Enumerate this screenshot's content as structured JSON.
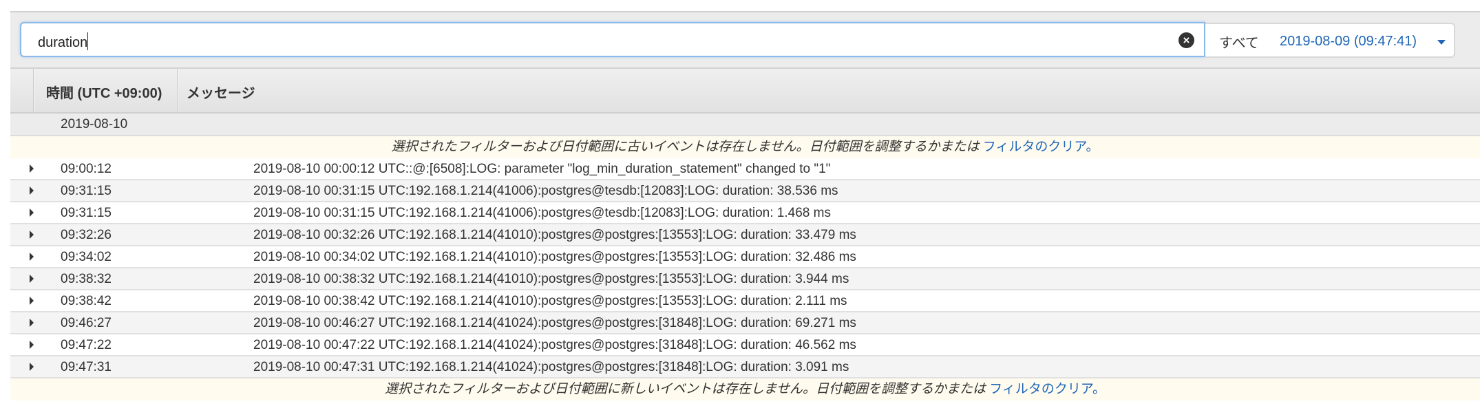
{
  "search": {
    "value": "duration",
    "clear_icon": "x-circle-icon"
  },
  "range": {
    "all_label": "すべて",
    "date_label": "2019-08-09 (09:47:41)"
  },
  "table": {
    "headers": [
      "時間 (UTC +09:00)",
      "メッセージ"
    ],
    "date_group": "2019-08-10",
    "notice_top": {
      "text": "選択されたフィルターおよび日付範囲に古いイベントは存在しません。日付範囲を調整するかまたは ",
      "link": "フィルタのクリア。"
    },
    "notice_bottom": {
      "text": "選択されたフィルターおよび日付範囲に新しいイベントは存在しません。日付範囲を調整するかまたは ",
      "link": "フィルタのクリア。"
    },
    "rows": [
      {
        "time": "09:00:12",
        "message": "2019-08-10 00:00:12 UTC::@:[6508]:LOG: parameter \"log_min_duration_statement\" changed to \"1\""
      },
      {
        "time": "09:31:15",
        "message": "2019-08-10 00:31:15 UTC:192.168.1.214(41006):postgres@tesdb:[12083]:LOG: duration: 38.536 ms"
      },
      {
        "time": "09:31:15",
        "message": "2019-08-10 00:31:15 UTC:192.168.1.214(41006):postgres@tesdb:[12083]:LOG: duration: 1.468 ms"
      },
      {
        "time": "09:32:26",
        "message": "2019-08-10 00:32:26 UTC:192.168.1.214(41010):postgres@postgres:[13553]:LOG: duration: 33.479 ms"
      },
      {
        "time": "09:34:02",
        "message": "2019-08-10 00:34:02 UTC:192.168.1.214(41010):postgres@postgres:[13553]:LOG: duration: 32.486 ms"
      },
      {
        "time": "09:38:32",
        "message": "2019-08-10 00:38:32 UTC:192.168.1.214(41010):postgres@postgres:[13553]:LOG: duration: 3.944 ms"
      },
      {
        "time": "09:38:42",
        "message": "2019-08-10 00:38:42 UTC:192.168.1.214(41010):postgres@postgres:[13553]:LOG: duration: 2.111 ms"
      },
      {
        "time": "09:46:27",
        "message": "2019-08-10 00:46:27 UTC:192.168.1.214(41024):postgres@postgres:[31848]:LOG: duration: 69.271 ms"
      },
      {
        "time": "09:47:22",
        "message": "2019-08-10 00:47:22 UTC:192.168.1.214(41024):postgres@postgres:[31848]:LOG: duration: 46.562 ms"
      },
      {
        "time": "09:47:31",
        "message": "2019-08-10 00:47:31 UTC:192.168.1.214(41024):postgres@postgres:[31848]:LOG: duration: 3.091 ms"
      }
    ]
  }
}
